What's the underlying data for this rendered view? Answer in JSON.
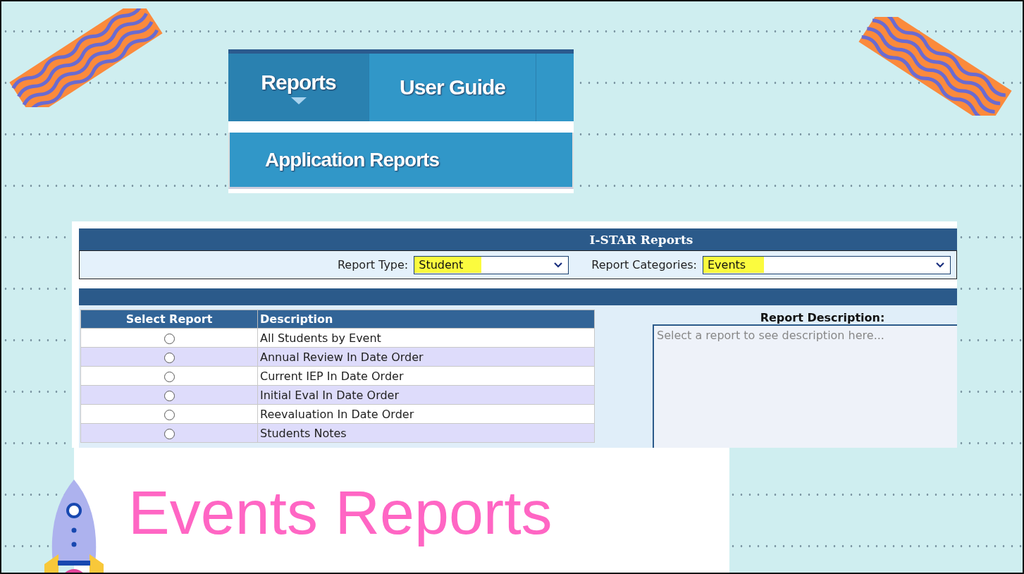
{
  "menu": {
    "tabs": [
      {
        "label": "Reports",
        "selected": true
      },
      {
        "label": "User Guide",
        "selected": false
      }
    ],
    "dropdown_items": [
      "Application Reports"
    ]
  },
  "report_panel": {
    "title": "I-STAR Reports",
    "filters": [
      {
        "label": "Report Type:",
        "value": "Student"
      },
      {
        "label": "Report Categories:",
        "value": "Events"
      }
    ],
    "table": {
      "columns": [
        "Select Report",
        "Description"
      ],
      "rows": [
        {
          "description": "All Students by Event",
          "selected": false
        },
        {
          "description": "Annual Review In Date Order",
          "selected": false
        },
        {
          "description": "Current IEP In Date Order",
          "selected": false
        },
        {
          "description": "Initial Eval In Date Order",
          "selected": false
        },
        {
          "description": "Reevaluation In Date Order",
          "selected": false
        },
        {
          "description": "Students Notes",
          "selected": false
        }
      ]
    },
    "description_panel": {
      "heading": "Report Description:",
      "placeholder": "Select a report to see description here..."
    }
  },
  "slide_title": "Events Reports"
}
